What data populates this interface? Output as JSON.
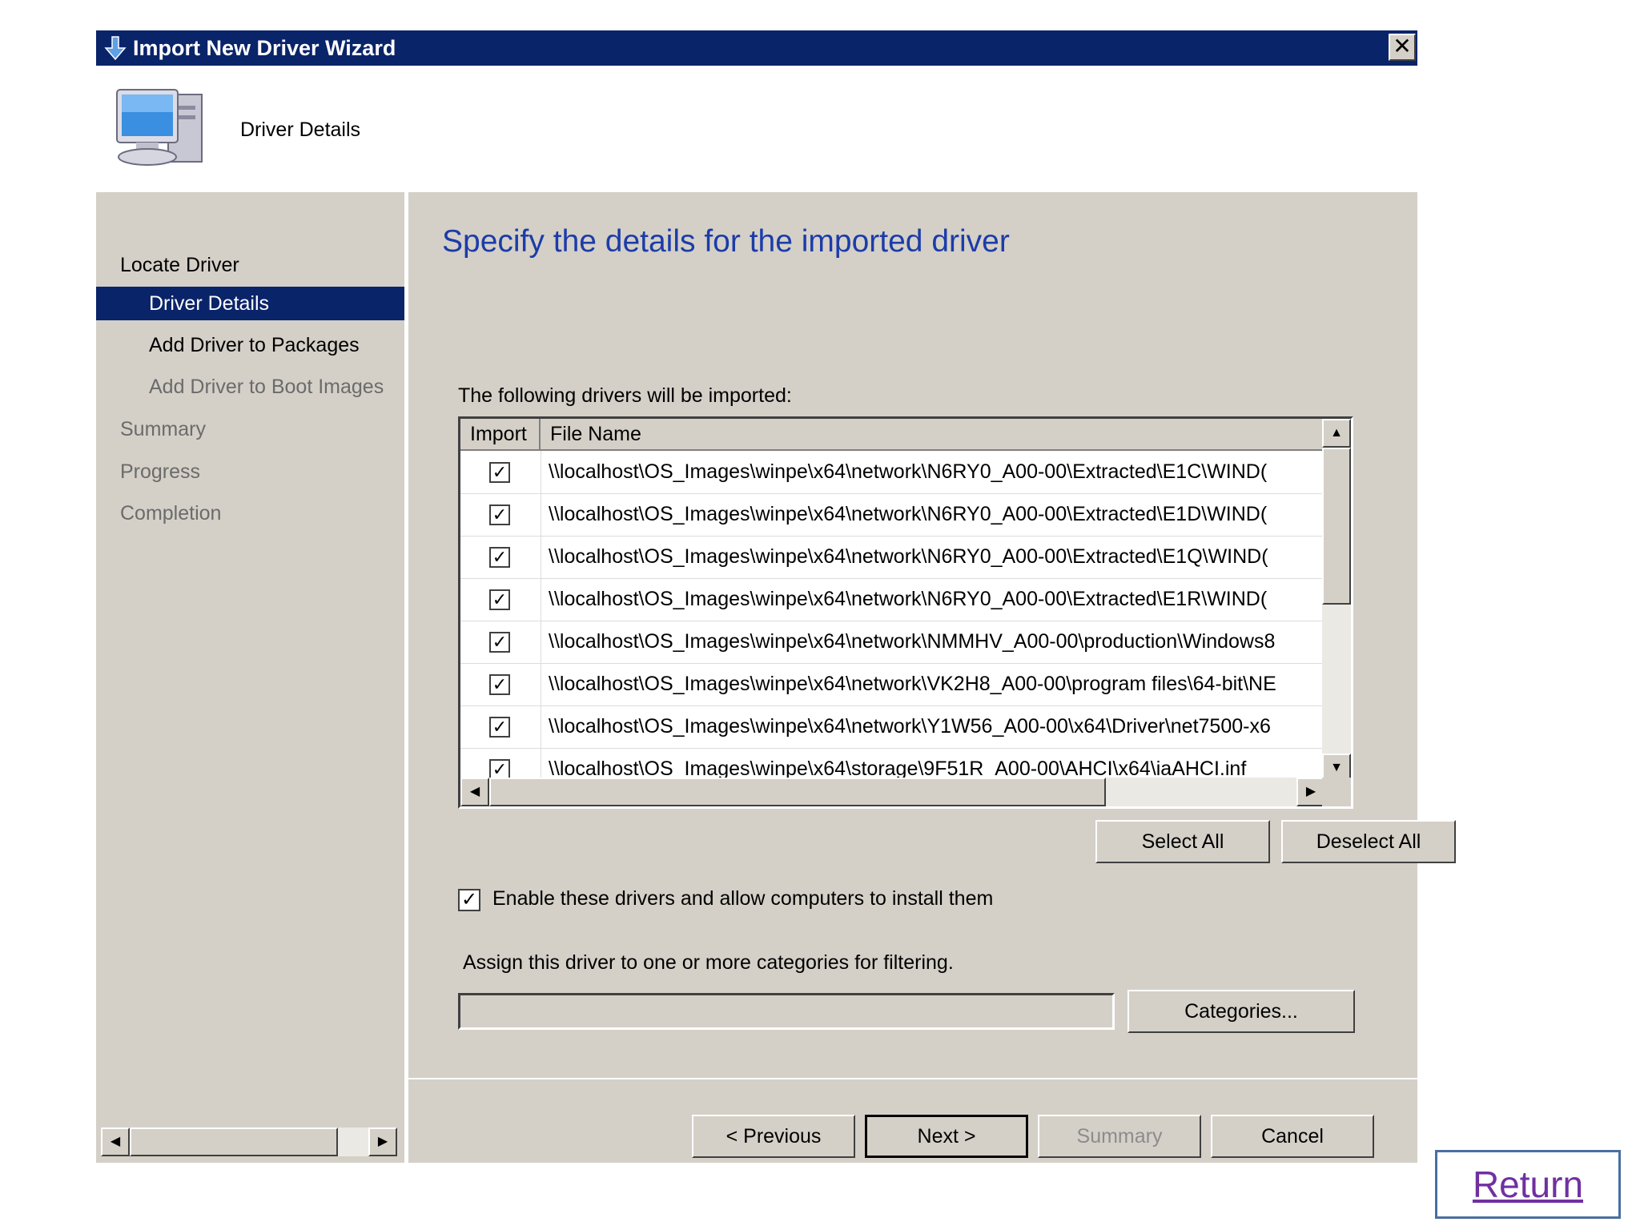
{
  "window": {
    "title": "Import New Driver Wizard",
    "close_label": "✕"
  },
  "header": {
    "title": "Driver Details"
  },
  "sidebar": {
    "items": [
      {
        "label": "Locate Driver"
      },
      {
        "label": "Driver Details"
      },
      {
        "label": "Add Driver to Packages"
      },
      {
        "label": "Add Driver to Boot Images"
      },
      {
        "label": "Summary"
      },
      {
        "label": "Progress"
      },
      {
        "label": "Completion"
      }
    ]
  },
  "main": {
    "heading": "Specify the details for the imported driver",
    "list_label": "The following drivers will be imported:",
    "columns": [
      "Import",
      "File Name"
    ],
    "rows": [
      {
        "checked": "✓",
        "file": "\\\\localhost\\OS_Images\\winpe\\x64\\network\\N6RY0_A00-00\\Extracted\\E1C\\WIND("
      },
      {
        "checked": "✓",
        "file": "\\\\localhost\\OS_Images\\winpe\\x64\\network\\N6RY0_A00-00\\Extracted\\E1D\\WIND("
      },
      {
        "checked": "✓",
        "file": "\\\\localhost\\OS_Images\\winpe\\x64\\network\\N6RY0_A00-00\\Extracted\\E1Q\\WIND("
      },
      {
        "checked": "✓",
        "file": "\\\\localhost\\OS_Images\\winpe\\x64\\network\\N6RY0_A00-00\\Extracted\\E1R\\WIND("
      },
      {
        "checked": "✓",
        "file": "\\\\localhost\\OS_Images\\winpe\\x64\\network\\NMMHV_A00-00\\production\\Windows8"
      },
      {
        "checked": "✓",
        "file": "\\\\localhost\\OS_Images\\winpe\\x64\\network\\VK2H8_A00-00\\program files\\64-bit\\NE"
      },
      {
        "checked": "✓",
        "file": "\\\\localhost\\OS_Images\\winpe\\x64\\network\\Y1W56_A00-00\\x64\\Driver\\net7500-x6"
      },
      {
        "checked": "✓",
        "file": "\\\\localhost\\OS_Images\\winpe\\x64\\storage\\9F51R_A00-00\\AHCI\\x64\\iaAHCI.inf"
      }
    ],
    "select_all": "Select All",
    "deselect_all": "Deselect All",
    "enable_checked": "✓",
    "enable_label": "Enable these drivers and allow computers to install them",
    "assign_label": "Assign this driver to one or more categories for filtering.",
    "categories_value": "",
    "categories_button": "Categories..."
  },
  "footer": {
    "previous": "< Previous",
    "next": "Next >",
    "summary": "Summary",
    "cancel": "Cancel"
  },
  "scroll": {
    "up": "▲",
    "down": "▼",
    "left": "◀",
    "right": "▶"
  },
  "return_link": "Return",
  "colors": {
    "title_bar": "#0a246a",
    "dialog_face": "#d4d0c8",
    "heading_blue": "#1c3ca8",
    "link_purple": "#7030a0"
  }
}
